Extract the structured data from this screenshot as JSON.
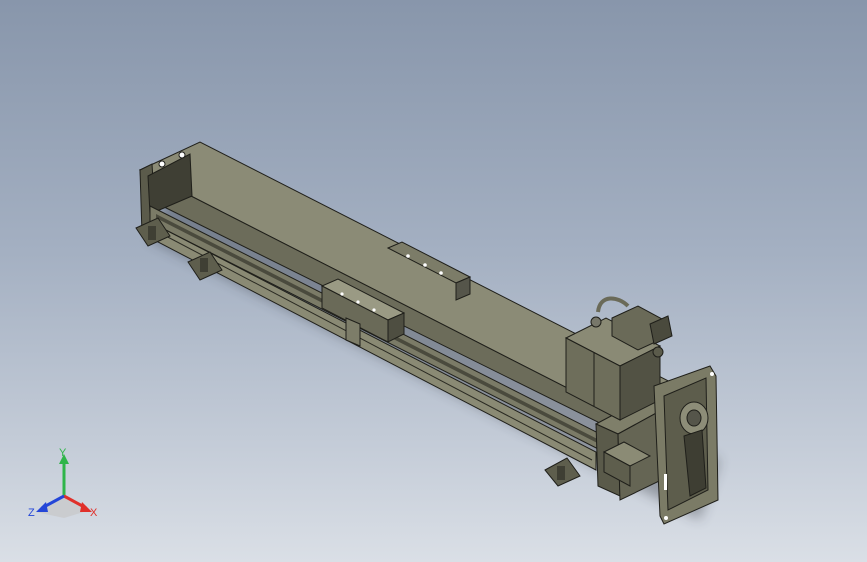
{
  "viewport": {
    "background_top": "#8896ab",
    "background_bottom": "#dadfe6"
  },
  "model": {
    "body_color": "#6f6f5d",
    "body_light": "#8c8c77",
    "body_dark": "#3f3f34",
    "edge_color": "#1f1f1a"
  },
  "triad": {
    "x_label": "X",
    "y_label": "Y",
    "z_label": "Z",
    "x_color": "#e0302a",
    "y_color": "#2fb54a",
    "z_color": "#2446d8"
  }
}
